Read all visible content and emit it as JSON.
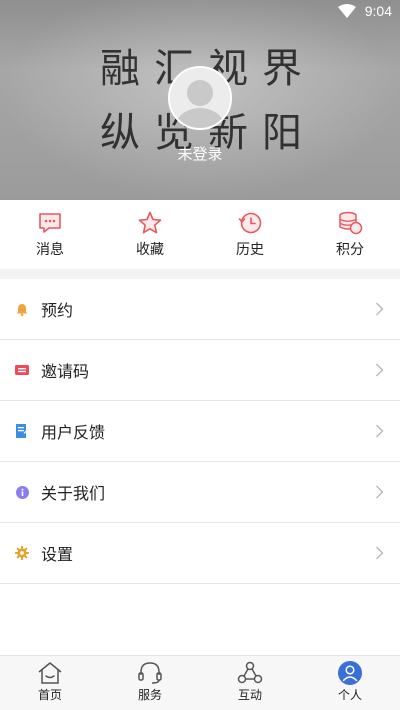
{
  "status": {
    "time": "9:04"
  },
  "header": {
    "login_text": "未登录",
    "calligraphy_line1": "融汇视界",
    "calligraphy_line2": "纵览新阳"
  },
  "quick_actions": [
    {
      "label": "消息",
      "icon": "message-icon"
    },
    {
      "label": "收藏",
      "icon": "star-icon"
    },
    {
      "label": "历史",
      "icon": "history-icon"
    },
    {
      "label": "积分",
      "icon": "coins-icon"
    }
  ],
  "menu": [
    {
      "label": "预约",
      "icon": "bell-icon",
      "color": "#f0a43c"
    },
    {
      "label": "邀请码",
      "icon": "ticket-icon",
      "color": "#ee4a5a"
    },
    {
      "label": "用户反馈",
      "icon": "feedback-icon",
      "color": "#3b8fe0"
    },
    {
      "label": "关于我们",
      "icon": "info-icon",
      "color": "#8b7cf0"
    },
    {
      "label": "设置",
      "icon": "gear-icon",
      "color": "#e3a32c"
    }
  ],
  "bottom_nav": [
    {
      "label": "首页",
      "icon": "home-icon"
    },
    {
      "label": "服务",
      "icon": "headset-icon"
    },
    {
      "label": "互动",
      "icon": "share-nodes-icon"
    },
    {
      "label": "个人",
      "icon": "person-icon",
      "active": true
    }
  ],
  "colors": {
    "accent": "#3a6fd8",
    "quick_icon": "#e35a5f"
  }
}
